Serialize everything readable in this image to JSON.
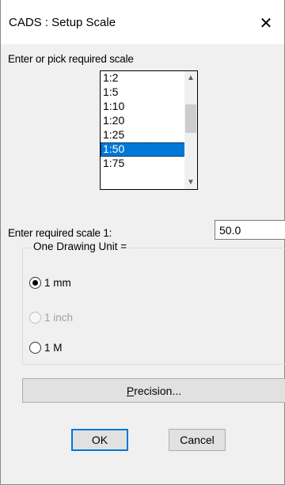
{
  "window": {
    "title": "CADS : Setup Scale",
    "close_symbol": "✕"
  },
  "prompt": {
    "label": "Enter or pick required scale"
  },
  "scale_list": {
    "items": [
      "1:2",
      "1:5",
      "1:10",
      "1:20",
      "1:25",
      "1:50",
      "1:75"
    ],
    "selected": "1:50",
    "scroll_up_symbol": "▲",
    "scroll_down_symbol": "▼"
  },
  "scale_entry": {
    "label": "Enter required scale  1:",
    "value": "50.0"
  },
  "drawing_unit": {
    "legend": "One Drawing Unit =",
    "options": [
      {
        "label": "1 mm",
        "checked": true,
        "disabled": false
      },
      {
        "label": "1 inch",
        "checked": false,
        "disabled": true
      },
      {
        "label": "1 M",
        "checked": false,
        "disabled": false
      }
    ]
  },
  "buttons": {
    "precision_mnemonic": "P",
    "precision_rest": "recision...",
    "ok": "OK",
    "cancel": "Cancel"
  }
}
